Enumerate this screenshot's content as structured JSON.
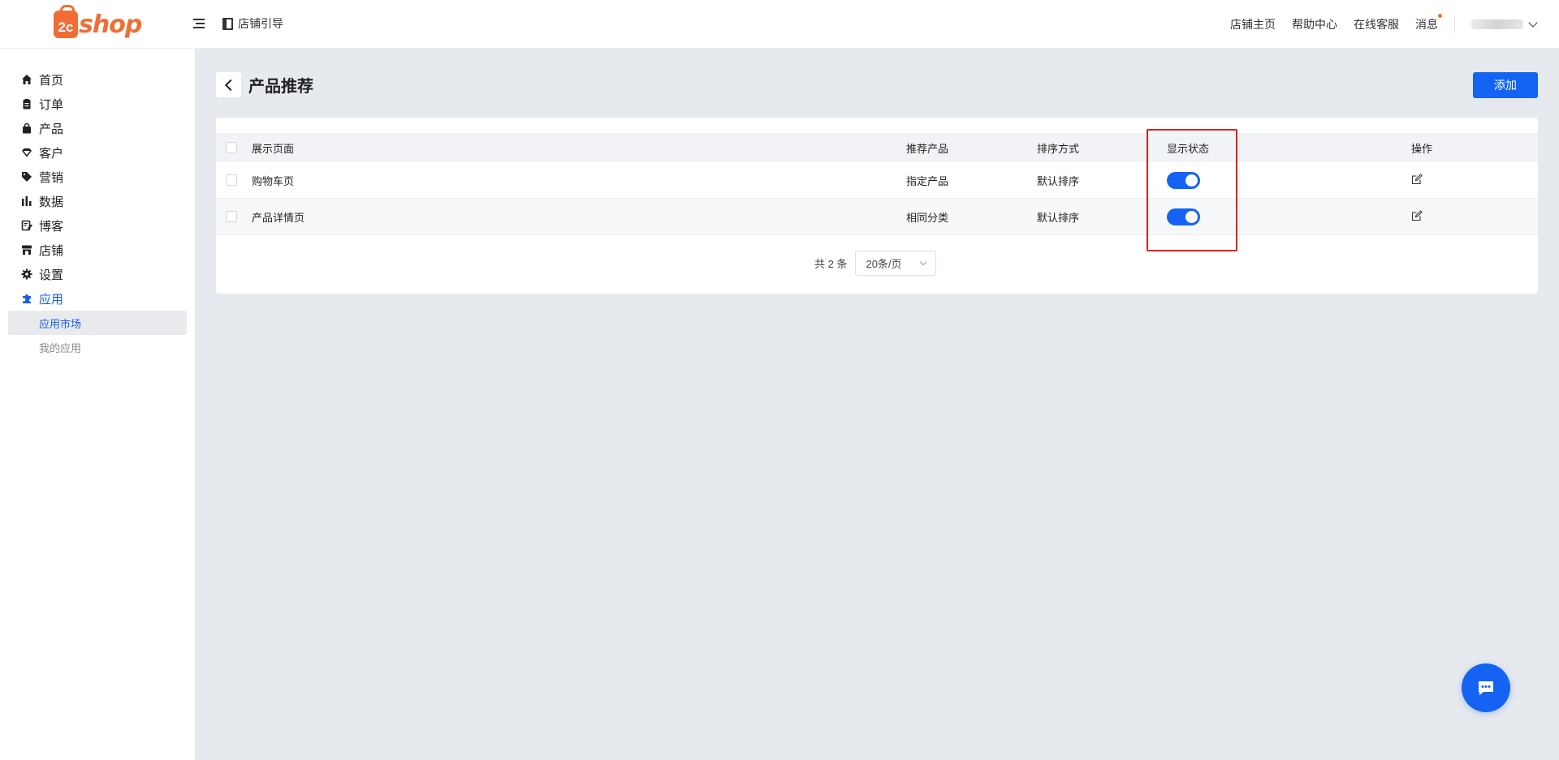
{
  "brand": {
    "logo_mark": "2c",
    "logo_text": "shop",
    "accent": "#f06e35"
  },
  "header": {
    "guide_label": "店铺引导",
    "links": [
      "店铺主页",
      "帮助中心",
      "在线客服"
    ],
    "messages_label": "消息"
  },
  "sidebar": {
    "items": [
      {
        "label": "首页",
        "icon": "home-icon"
      },
      {
        "label": "订单",
        "icon": "clipboard-icon"
      },
      {
        "label": "产品",
        "icon": "bag-icon"
      },
      {
        "label": "客户",
        "icon": "gem-icon"
      },
      {
        "label": "营销",
        "icon": "tag-icon"
      },
      {
        "label": "数据",
        "icon": "bar-chart-icon"
      },
      {
        "label": "博客",
        "icon": "edit-note-icon"
      },
      {
        "label": "店铺",
        "icon": "store-icon"
      },
      {
        "label": "设置",
        "icon": "gear-icon"
      },
      {
        "label": "应用",
        "icon": "puzzle-icon",
        "active": true
      }
    ],
    "sub_items": [
      {
        "label": "应用市场",
        "active": true
      },
      {
        "label": "我的应用"
      }
    ]
  },
  "page": {
    "title": "产品推荐",
    "add_label": "添加"
  },
  "table": {
    "columns": [
      "展示页面",
      "推荐产品",
      "排序方式",
      "显示状态",
      "操作"
    ],
    "rows": [
      {
        "page": "购物车页",
        "product": "指定产品",
        "sort": "默认排序",
        "status_on": true
      },
      {
        "page": "产品详情页",
        "product": "相同分类",
        "sort": "默认排序",
        "status_on": true
      }
    ]
  },
  "pagination": {
    "total": "共 2 条",
    "page_size": "20条/页"
  },
  "colors": {
    "primary": "#1463f3",
    "active_nav": "#1a5ee8",
    "highlight": "#e02020"
  }
}
